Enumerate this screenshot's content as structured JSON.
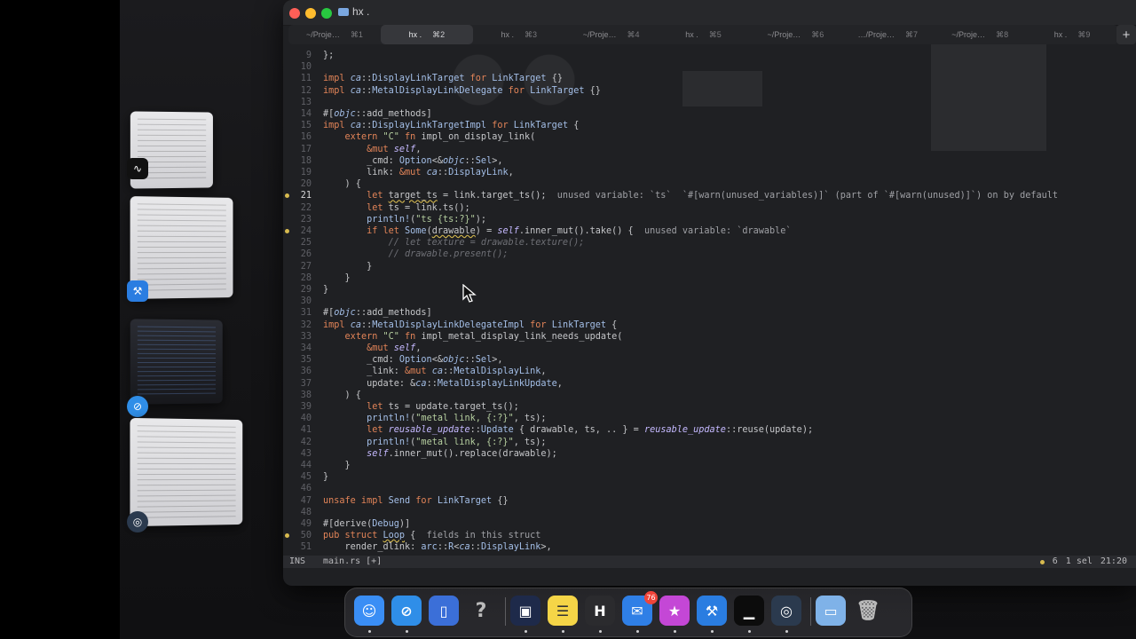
{
  "window": {
    "title": "hx ."
  },
  "tabs": [
    {
      "label": "~/Proje…",
      "shortcut": "⌘1",
      "active": false
    },
    {
      "label": "hx .",
      "shortcut": "⌘2",
      "active": true
    },
    {
      "label": "hx .",
      "shortcut": "⌘3",
      "active": false
    },
    {
      "label": "~/Proje…",
      "shortcut": "⌘4",
      "active": false
    },
    {
      "label": "hx .",
      "shortcut": "⌘5",
      "active": false
    },
    {
      "label": "~/Proje…",
      "shortcut": "⌘6",
      "active": false
    },
    {
      "label": "…/Proje…",
      "shortcut": "⌘7",
      "active": false
    },
    {
      "label": "~/Proje…",
      "shortcut": "⌘8",
      "active": false
    },
    {
      "label": "hx .",
      "shortcut": "⌘9",
      "active": false
    }
  ],
  "new_tab_label": "+",
  "editor": {
    "lines": [
      {
        "n": "9",
        "html": "};"
      },
      {
        "n": "10",
        "html": ""
      },
      {
        "n": "11",
        "html": "<span class=\"kw\">impl</span> <span class=\"ns\">ca</span>::<span class=\"ty\">DisplayLinkTarget</span> <span class=\"kw\">for</span> <span class=\"ty\">LinkTarget</span> {}"
      },
      {
        "n": "12",
        "html": "<span class=\"kw\">impl</span> <span class=\"ns\">ca</span>::<span class=\"ty\">MetalDisplayLinkDelegate</span> <span class=\"kw\">for</span> <span class=\"ty\">LinkTarget</span> {}"
      },
      {
        "n": "13",
        "html": ""
      },
      {
        "n": "14",
        "html": "#[<span class=\"ns\">objc</span>::add_methods]"
      },
      {
        "n": "15",
        "html": "<span class=\"kw\">impl</span> <span class=\"ns\">ca</span>::<span class=\"ty\">DisplayLinkTargetImpl</span> <span class=\"kw\">for</span> <span class=\"ty\">LinkTarget</span> {"
      },
      {
        "n": "16",
        "html": "    <span class=\"kw\">extern</span> <span class=\"st\">\"C\"</span> <span class=\"kw\">fn</span> impl_on_display_link("
      },
      {
        "n": "17",
        "html": "        <span class=\"kw\">&amp;mut</span> <span class=\"it\">self</span>,"
      },
      {
        "n": "18",
        "html": "        _cmd: <span class=\"ty\">Option</span>&lt;&amp;<span class=\"ns\">objc</span>::<span class=\"ty\">Sel</span>&gt;,"
      },
      {
        "n": "19",
        "html": "        link: <span class=\"kw\">&amp;mut</span> <span class=\"ns\">ca</span>::<span class=\"ty\">DisplayLink</span>,"
      },
      {
        "n": "20",
        "html": "    ) {"
      },
      {
        "n": "21",
        "html": "        <span class=\"kw\">let</span> <span class=\"un\">target_ts</span> = link.target_ts();  <span class=\"warn\">unused variable: `ts`  `#[warn(unused_variables)]` (part of `#[warn(unused)]`) on by default</span>",
        "warn": true,
        "cur": true
      },
      {
        "n": "22",
        "html": "        <span class=\"kw\">let</span> ts = link.ts();"
      },
      {
        "n": "23",
        "html": "        <span class=\"mc\">println!</span>(<span class=\"st\">\"ts {ts:?}\"</span>);"
      },
      {
        "n": "24",
        "html": "        <span class=\"kw\">if let</span> <span class=\"ty\">Some</span>(<span class=\"un\">drawable</span>) = <span class=\"it\">self</span>.inner_mut().take() {  <span class=\"warn\">unused variable: `drawable`</span>",
        "warn": true
      },
      {
        "n": "25",
        "html": "            <span class=\"cm\">// let texture = drawable.texture();</span>"
      },
      {
        "n": "26",
        "html": "            <span class=\"cm\">// drawable.present();</span>"
      },
      {
        "n": "27",
        "html": "        }"
      },
      {
        "n": "28",
        "html": "    }"
      },
      {
        "n": "29",
        "html": "}"
      },
      {
        "n": "30",
        "html": ""
      },
      {
        "n": "31",
        "html": "#[<span class=\"ns\">objc</span>::add_methods]"
      },
      {
        "n": "32",
        "html": "<span class=\"kw\">impl</span> <span class=\"ns\">ca</span>::<span class=\"ty\">MetalDisplayLinkDelegateImpl</span> <span class=\"kw\">for</span> <span class=\"ty\">LinkTarget</span> {"
      },
      {
        "n": "33",
        "html": "    <span class=\"kw\">extern</span> <span class=\"st\">\"C\"</span> <span class=\"kw\">fn</span> impl_metal_display_link_needs_update("
      },
      {
        "n": "34",
        "html": "        <span class=\"kw\">&amp;mut</span> <span class=\"it\">self</span>,"
      },
      {
        "n": "35",
        "html": "        _cmd: <span class=\"ty\">Option</span>&lt;&amp;<span class=\"ns\">objc</span>::<span class=\"ty\">Sel</span>&gt;,"
      },
      {
        "n": "36",
        "html": "        _link: <span class=\"kw\">&amp;mut</span> <span class=\"ns\">ca</span>::<span class=\"ty\">MetalDisplayLink</span>,"
      },
      {
        "n": "37",
        "html": "        update: &amp;<span class=\"ns\">ca</span>::<span class=\"ty\">MetalDisplayLinkUpdate</span>,"
      },
      {
        "n": "38",
        "html": "    ) {"
      },
      {
        "n": "39",
        "html": "        <span class=\"kw\">let</span> ts = update.target_ts();"
      },
      {
        "n": "40",
        "html": "        <span class=\"mc\">println!</span>(<span class=\"st\">\"metal link, {:?}\"</span>, ts);"
      },
      {
        "n": "41",
        "html": "        <span class=\"kw\">let</span> <span class=\"it\">reusable_update</span>::<span class=\"ty\">Update</span> { drawable, ts, .. } = <span class=\"it\">reusable_update</span>::reuse(update);"
      },
      {
        "n": "42",
        "html": "        <span class=\"mc\">println!</span>(<span class=\"st\">\"metal link, {:?}\"</span>, ts);"
      },
      {
        "n": "43",
        "html": "        <span class=\"it\">self</span>.inner_mut().replace(drawable);"
      },
      {
        "n": "44",
        "html": "    }"
      },
      {
        "n": "45",
        "html": "}"
      },
      {
        "n": "46",
        "html": ""
      },
      {
        "n": "47",
        "html": "<span class=\"kw\">unsafe impl</span> <span class=\"ty\">Send</span> <span class=\"kw\">for</span> <span class=\"ty\">LinkTarget</span> {}"
      },
      {
        "n": "48",
        "html": ""
      },
      {
        "n": "49",
        "html": "#[derive(<span class=\"ty\">Debug</span>)]"
      },
      {
        "n": "50",
        "html": "<span class=\"kw\">pub struct</span> <span class=\"ty un\">Loop</span> {  <span class=\"warn\">fields in this struct</span>",
        "warn": true
      },
      {
        "n": "51",
        "html": "    render_dlink: <span class=\"ty\">arc</span>::<span class=\"ty\">R</span>&lt;<span class=\"ns\">ca</span>::<span class=\"ty\">DisplayLink</span>&gt;,"
      }
    ]
  },
  "status": {
    "mode": "INS",
    "file": "main.rs [+]",
    "warnings": "6",
    "selections": "1 sel",
    "position": "21:20"
  },
  "dock": [
    {
      "name": "finder-icon",
      "label": "☺",
      "color": "#3a8ef5",
      "running": true
    },
    {
      "name": "safari-icon",
      "label": "⊘",
      "color": "#2f8ee8",
      "running": true
    },
    {
      "name": "notes-app-icon",
      "label": "▯",
      "color": "#3b6fd8",
      "running": false
    },
    {
      "name": "help-icon",
      "label": "?",
      "color": "transparent",
      "running": false
    },
    {
      "name": "simulator-icon",
      "label": "▣",
      "color": "#1e2a4a",
      "running": true
    },
    {
      "name": "notes-icon",
      "label": "☰",
      "color": "#f5d547",
      "running": true
    },
    {
      "name": "helix-icon",
      "label": "H",
      "color": "#2b2b2e",
      "running": true
    },
    {
      "name": "mail-icon",
      "label": "✉",
      "color": "#2f7fe6",
      "running": true,
      "badge": "76"
    },
    {
      "name": "feedback-icon",
      "label": "★",
      "color": "#c447d6",
      "running": true
    },
    {
      "name": "xcode-icon",
      "label": "⚒",
      "color": "#2a7de1",
      "running": true
    },
    {
      "name": "activity-monitor-icon",
      "label": "▁",
      "color": "#0c0c0c",
      "running": true
    },
    {
      "name": "instruments-icon",
      "label": "◎",
      "color": "#2b3a4e",
      "running": true
    },
    {
      "name": "downloads-folder-icon",
      "label": "▭",
      "color": "#7fb2e8",
      "running": false
    },
    {
      "name": "trash-icon",
      "label": "🗑",
      "color": "transparent",
      "running": false
    }
  ]
}
